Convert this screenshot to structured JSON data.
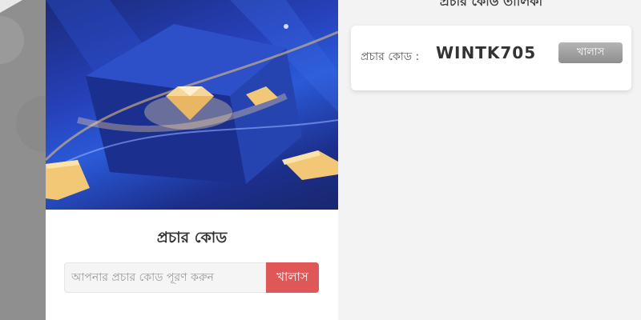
{
  "promo_card": {
    "title": "প্রচার কোড",
    "input_placeholder": "আপনার প্রচার কোড পূরণ করুন",
    "input_value": "",
    "submit_label": "খালাস"
  },
  "promo_list": {
    "title": "প্রচার কোড তালিকা",
    "items": [
      {
        "label": "প্রচার কোড :",
        "code": "WINTK705",
        "action_label": "খালাস"
      }
    ]
  },
  "colors": {
    "accent_red": "#e05757",
    "banner_blue": "#2640b8",
    "gold": "#f2c877",
    "button_gray": "#9e9e9e"
  },
  "icons": [
    "diamond-icon",
    "ticket-icon"
  ]
}
